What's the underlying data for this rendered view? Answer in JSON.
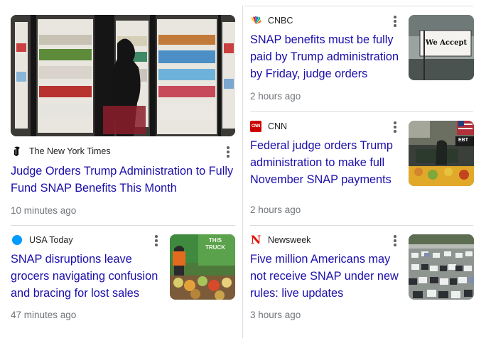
{
  "articles": [
    {
      "source": "The New York Times",
      "logo_icon": "nyt-logo-icon",
      "title": "Judge Orders Trump Administration to Fully Fund SNAP Benefits This Month",
      "time": "10 minutes ago",
      "image_icon": "grocery-cooler-image"
    },
    {
      "source": "CNBC",
      "logo_icon": "cnbc-peacock-logo-icon",
      "title": "SNAP benefits must be fully paid by Trump administration by Friday, judge orders",
      "time": "2 hours ago",
      "image_icon": "we-accept-sign-image",
      "image_text": "We Accept"
    },
    {
      "source": "CNN",
      "logo_icon": "cnn-logo-icon",
      "logo_text": "CNN",
      "title": "Federal judge orders Trump administration to make full November SNAP payments",
      "time": "2 hours ago",
      "image_icon": "grocery-store-image",
      "image_text": "EBT"
    },
    {
      "source": "USA Today",
      "logo_icon": "usa-today-dot-icon",
      "title": "SNAP disruptions leave grocers navigating confusion and bracing for lost sales",
      "time": "47 minutes ago",
      "image_icon": "food-truck-produce-image",
      "image_text": "THIS TRUCK"
    },
    {
      "source": "Newsweek",
      "logo_icon": "newsweek-logo-icon",
      "logo_text": "N",
      "title": "Five million Americans may not receive SNAP under new rules: live updates",
      "time": "3 hours ago",
      "image_icon": "parking-lot-aerial-image"
    }
  ],
  "colors": {
    "link": "#1a0dab",
    "meta": "#70757a",
    "divider": "#dadce0",
    "cnn_red": "#cc0000",
    "newsweek_red": "#e3120b",
    "usa_today_blue": "#009bff"
  }
}
